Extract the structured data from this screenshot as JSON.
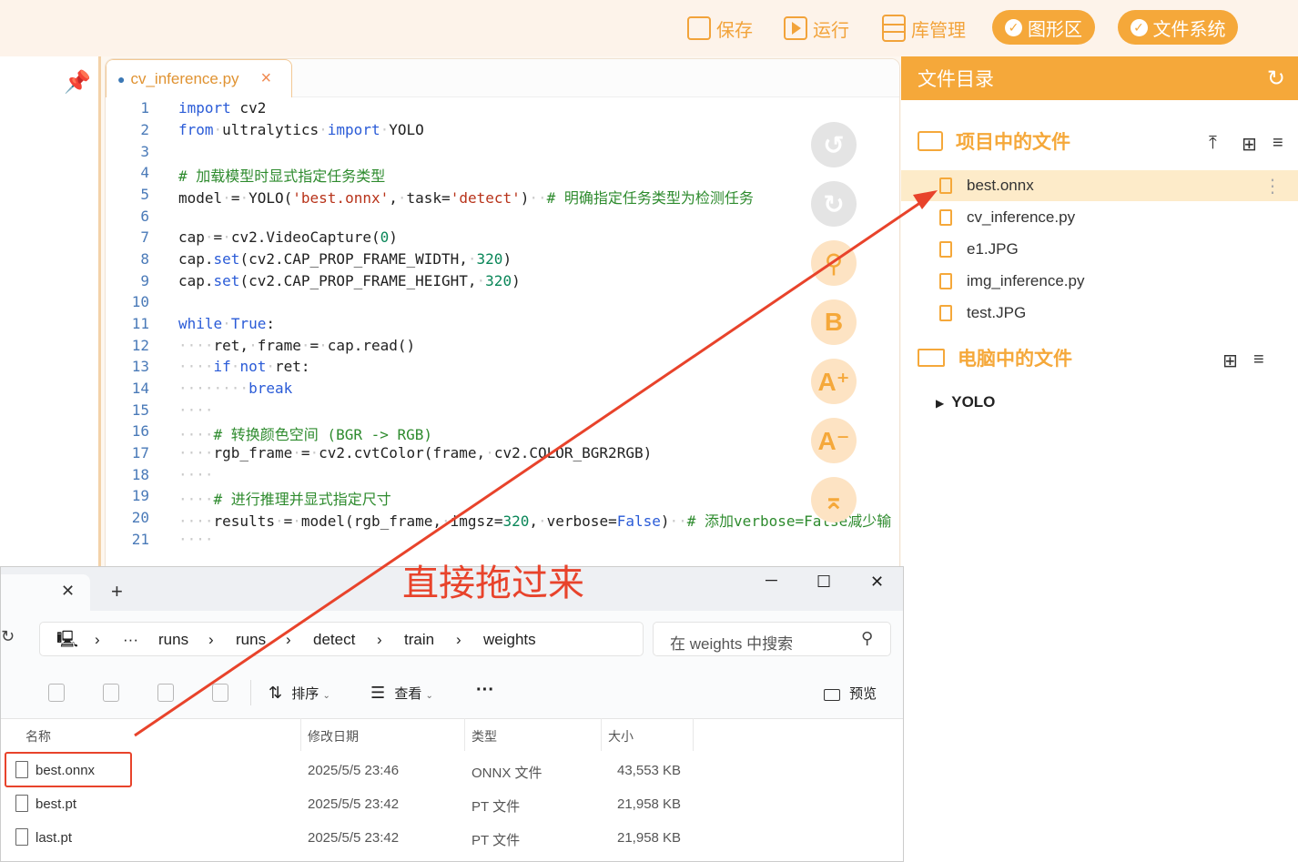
{
  "toolbar": {
    "save_label": "保存",
    "run_label": "运行",
    "library_label": "库管理",
    "graphic_label": "图形区",
    "filesystem_label": "文件系统"
  },
  "editor": {
    "tab_label": "cv_inference.py",
    "close_glyph": "×",
    "line_numbers": [
      "1",
      "2",
      "3",
      "4",
      "5",
      "6",
      "7",
      "8",
      "9",
      "10",
      "11",
      "12",
      "13",
      "14",
      "15",
      "16",
      "17",
      "18",
      "19",
      "20",
      "21"
    ]
  },
  "file_panel": {
    "title": "文件目录",
    "project_section": "项目中的文件",
    "project_files": [
      "best.onnx",
      "cv_inference.py",
      "e1.JPG",
      "img_inference.py",
      "test.JPG"
    ],
    "computer_section": "电脑中的文件",
    "folder": "YOLO"
  },
  "annotation": {
    "text": "直接拖过来"
  },
  "explorer": {
    "path": [
      "···",
      "runs",
      "runs",
      "detect",
      "train",
      "weights"
    ],
    "search_placeholder": "在 weights 中搜索",
    "sort_label": "排序",
    "view_label": "查看",
    "more_label": "···",
    "preview_label": "预览",
    "columns": {
      "name": "名称",
      "modified": "修改日期",
      "type": "类型",
      "size": "大小"
    },
    "rows": [
      {
        "name": "best.onnx",
        "modified": "2025/5/5 23:46",
        "type": "ONNX 文件",
        "size": "43,553 KB"
      },
      {
        "name": "best.pt",
        "modified": "2025/5/5 23:42",
        "type": "PT 文件",
        "size": "21,958 KB"
      },
      {
        "name": "last.pt",
        "modified": "2025/5/5 23:42",
        "type": "PT 文件",
        "size": "21,958 KB"
      }
    ]
  },
  "colors": {
    "accent": "#f5a83a",
    "annotation": "#e8432b"
  }
}
